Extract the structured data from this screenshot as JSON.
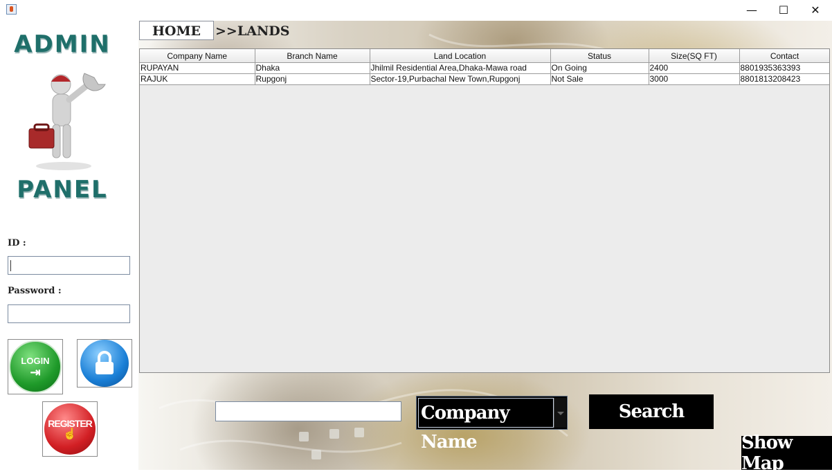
{
  "window": {
    "minimize_glyph": "—",
    "maximize_glyph": "☐",
    "close_glyph": "✕"
  },
  "sidebar": {
    "logo_top": "ADMIN",
    "logo_bottom": "PANEL",
    "id_label": "ID :",
    "id_value": "",
    "password_label": "Password :",
    "password_value": "",
    "login_button_label": "LOGIN",
    "register_button_label": "REGISTER"
  },
  "breadcrumb": {
    "home": "HOME",
    "current": ">>LANDS"
  },
  "table": {
    "columns": [
      "Company Name",
      "Branch Name",
      "Land Location",
      "Status",
      "Size(SQ FT)",
      "Contact"
    ],
    "rows": [
      [
        "RUPAYAN",
        "Dhaka",
        "Jhilmil Residential Area,Dhaka-Mawa road",
        "On Going",
        "2400",
        "8801935363393"
      ],
      [
        "RAJUK",
        "Rupgonj",
        "Sector-19,Purbachal New Town,Rupgonj",
        "Not Sale",
        "3000",
        "8801813208423"
      ]
    ]
  },
  "search": {
    "input_value": "",
    "filter_selected": "Company Name",
    "search_button_label": "Search",
    "show_map_button_label": "Show Map"
  }
}
